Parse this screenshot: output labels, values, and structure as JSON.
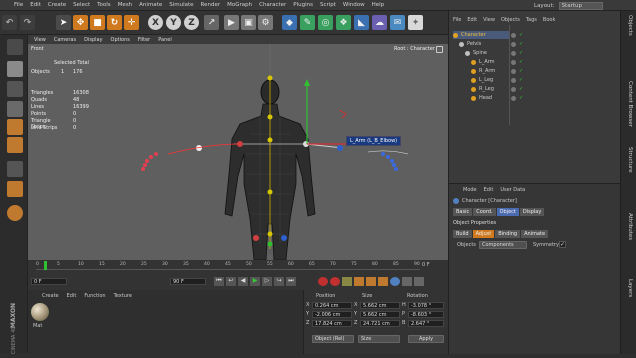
{
  "menubar": {
    "items": [
      "File",
      "Edit",
      "Create",
      "Select",
      "Tools",
      "Mesh",
      "Animate",
      "Simulate",
      "Render",
      "MoGraph",
      "Character",
      "Plugins",
      "Script",
      "Window",
      "Help"
    ]
  },
  "layout": {
    "label": "Layout:",
    "value": "Startup"
  },
  "viewport": {
    "menu": [
      "View",
      "Cameras",
      "Display",
      "Options",
      "Filter",
      "Panel"
    ],
    "name": "Front",
    "camera_label": "Root : Character",
    "stats_header": "Selected Total",
    "stats": [
      {
        "label": "Objects",
        "sel": "1",
        "total": "176"
      },
      {
        "label": "Triangles",
        "sel": "",
        "total": "16308"
      },
      {
        "label": "Quads",
        "sel": "",
        "total": "48"
      },
      {
        "label": "Lines",
        "sel": "",
        "total": "16399"
      },
      {
        "label": "Points",
        "sel": "",
        "total": "0"
      },
      {
        "label": "Triangle Strips",
        "sel": "",
        "total": "0"
      },
      {
        "label": "Line Strips",
        "sel": "",
        "total": "0"
      }
    ],
    "tooltip": "L_Arm (L_B_Elbow)"
  },
  "timeline": {
    "ticks": [
      "0",
      "5",
      "10",
      "15",
      "20",
      "25",
      "30",
      "35",
      "40",
      "45",
      "50",
      "55",
      "60",
      "65",
      "70",
      "75",
      "80",
      "85",
      "90"
    ],
    "frame_end_label": "0 F",
    "start_field": "0 F",
    "end_field": "90 F",
    "current": "0 F"
  },
  "material": {
    "menu": [
      "Create",
      "Edit",
      "Function",
      "Texture"
    ],
    "name": "Mat"
  },
  "coords": {
    "headers": [
      "Position",
      "Size",
      "Rotation"
    ],
    "rows": [
      {
        "axis": "X",
        "pos": "0.264 cm",
        "size_axis": "X",
        "size": "5.662 cm",
        "rot_axis": "H",
        "rot": "-3.078 °"
      },
      {
        "axis": "Y",
        "pos": "-2.006 cm",
        "size_axis": "Y",
        "size": "5.662 cm",
        "rot_axis": "P",
        "rot": "-8.603 °"
      },
      {
        "axis": "Z",
        "pos": "17.824 cm",
        "size_axis": "Z",
        "size": "24.721 cm",
        "rot_axis": "B",
        "rot": "2.647 °"
      }
    ],
    "mode": "Object (Rel)",
    "size_mode": "Size",
    "apply": "Apply"
  },
  "objmgr": {
    "menu": [
      "File",
      "Edit",
      "View",
      "Objects",
      "Tags",
      "Book"
    ],
    "tree": [
      {
        "label": "Character",
        "indent": 0,
        "color": "#e0a020",
        "selected": true
      },
      {
        "label": "Pelvis",
        "indent": 1,
        "color": "#c0c0c0",
        "selected": false
      },
      {
        "label": "Spine",
        "indent": 2,
        "color": "#c0c0c0",
        "selected": false
      },
      {
        "label": "L_Arm",
        "indent": 3,
        "color": "#e0a020",
        "selected": false
      },
      {
        "label": "R_Arm",
        "indent": 3,
        "color": "#e0a020",
        "selected": false
      },
      {
        "label": "L_Leg",
        "indent": 3,
        "color": "#e0a020",
        "selected": false
      },
      {
        "label": "R_Leg",
        "indent": 3,
        "color": "#e0a020",
        "selected": false
      },
      {
        "label": "Head",
        "indent": 3,
        "color": "#e0a020",
        "selected": false
      }
    ]
  },
  "attrmgr": {
    "menu": [
      "Mode",
      "Edit",
      "User Data"
    ],
    "title": "Character [Character]",
    "tabs1": [
      "Basic",
      "Coord.",
      "Object",
      "Display"
    ],
    "active_tab1": "Object",
    "section": "Object Properties",
    "tabs2": [
      "Build",
      "Adjust",
      "Binding",
      "Animate"
    ],
    "active_tab2": "Adjust",
    "objects_label": "Objects",
    "objects_value": "Components",
    "symmetry_label": "Symmetry",
    "symmetry_checked": true
  },
  "sidebar_tabs": [
    "Objects",
    "Content Browser",
    "Structure",
    "Attributes",
    "Layers"
  ],
  "logo": {
    "line1": "MAXON",
    "line2": "CINEMA 4D"
  }
}
